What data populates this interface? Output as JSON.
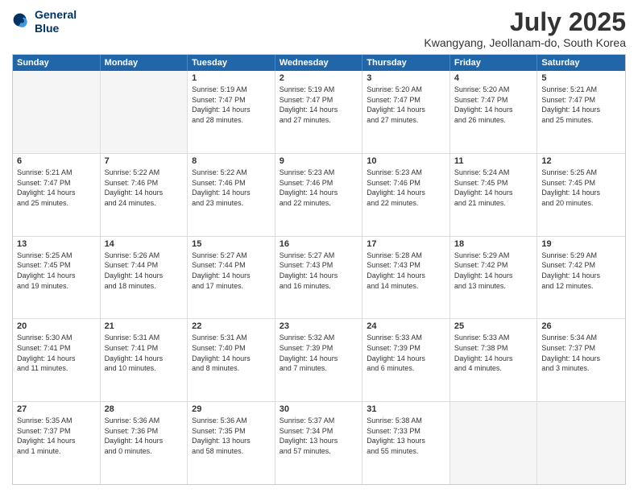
{
  "header": {
    "logo_line1": "General",
    "logo_line2": "Blue",
    "month": "July 2025",
    "location": "Kwangyang, Jeollanam-do, South Korea"
  },
  "weekdays": [
    "Sunday",
    "Monday",
    "Tuesday",
    "Wednesday",
    "Thursday",
    "Friday",
    "Saturday"
  ],
  "rows": [
    [
      {
        "day": "",
        "empty": true
      },
      {
        "day": "",
        "empty": true
      },
      {
        "day": "1",
        "lines": [
          "Sunrise: 5:19 AM",
          "Sunset: 7:47 PM",
          "Daylight: 14 hours",
          "and 28 minutes."
        ]
      },
      {
        "day": "2",
        "lines": [
          "Sunrise: 5:19 AM",
          "Sunset: 7:47 PM",
          "Daylight: 14 hours",
          "and 27 minutes."
        ]
      },
      {
        "day": "3",
        "lines": [
          "Sunrise: 5:20 AM",
          "Sunset: 7:47 PM",
          "Daylight: 14 hours",
          "and 27 minutes."
        ]
      },
      {
        "day": "4",
        "lines": [
          "Sunrise: 5:20 AM",
          "Sunset: 7:47 PM",
          "Daylight: 14 hours",
          "and 26 minutes."
        ]
      },
      {
        "day": "5",
        "lines": [
          "Sunrise: 5:21 AM",
          "Sunset: 7:47 PM",
          "Daylight: 14 hours",
          "and 25 minutes."
        ]
      }
    ],
    [
      {
        "day": "6",
        "lines": [
          "Sunrise: 5:21 AM",
          "Sunset: 7:47 PM",
          "Daylight: 14 hours",
          "and 25 minutes."
        ]
      },
      {
        "day": "7",
        "lines": [
          "Sunrise: 5:22 AM",
          "Sunset: 7:46 PM",
          "Daylight: 14 hours",
          "and 24 minutes."
        ]
      },
      {
        "day": "8",
        "lines": [
          "Sunrise: 5:22 AM",
          "Sunset: 7:46 PM",
          "Daylight: 14 hours",
          "and 23 minutes."
        ]
      },
      {
        "day": "9",
        "lines": [
          "Sunrise: 5:23 AM",
          "Sunset: 7:46 PM",
          "Daylight: 14 hours",
          "and 22 minutes."
        ]
      },
      {
        "day": "10",
        "lines": [
          "Sunrise: 5:23 AM",
          "Sunset: 7:46 PM",
          "Daylight: 14 hours",
          "and 22 minutes."
        ]
      },
      {
        "day": "11",
        "lines": [
          "Sunrise: 5:24 AM",
          "Sunset: 7:45 PM",
          "Daylight: 14 hours",
          "and 21 minutes."
        ]
      },
      {
        "day": "12",
        "lines": [
          "Sunrise: 5:25 AM",
          "Sunset: 7:45 PM",
          "Daylight: 14 hours",
          "and 20 minutes."
        ]
      }
    ],
    [
      {
        "day": "13",
        "lines": [
          "Sunrise: 5:25 AM",
          "Sunset: 7:45 PM",
          "Daylight: 14 hours",
          "and 19 minutes."
        ]
      },
      {
        "day": "14",
        "lines": [
          "Sunrise: 5:26 AM",
          "Sunset: 7:44 PM",
          "Daylight: 14 hours",
          "and 18 minutes."
        ]
      },
      {
        "day": "15",
        "lines": [
          "Sunrise: 5:27 AM",
          "Sunset: 7:44 PM",
          "Daylight: 14 hours",
          "and 17 minutes."
        ]
      },
      {
        "day": "16",
        "lines": [
          "Sunrise: 5:27 AM",
          "Sunset: 7:43 PM",
          "Daylight: 14 hours",
          "and 16 minutes."
        ]
      },
      {
        "day": "17",
        "lines": [
          "Sunrise: 5:28 AM",
          "Sunset: 7:43 PM",
          "Daylight: 14 hours",
          "and 14 minutes."
        ]
      },
      {
        "day": "18",
        "lines": [
          "Sunrise: 5:29 AM",
          "Sunset: 7:42 PM",
          "Daylight: 14 hours",
          "and 13 minutes."
        ]
      },
      {
        "day": "19",
        "lines": [
          "Sunrise: 5:29 AM",
          "Sunset: 7:42 PM",
          "Daylight: 14 hours",
          "and 12 minutes."
        ]
      }
    ],
    [
      {
        "day": "20",
        "lines": [
          "Sunrise: 5:30 AM",
          "Sunset: 7:41 PM",
          "Daylight: 14 hours",
          "and 11 minutes."
        ]
      },
      {
        "day": "21",
        "lines": [
          "Sunrise: 5:31 AM",
          "Sunset: 7:41 PM",
          "Daylight: 14 hours",
          "and 10 minutes."
        ]
      },
      {
        "day": "22",
        "lines": [
          "Sunrise: 5:31 AM",
          "Sunset: 7:40 PM",
          "Daylight: 14 hours",
          "and 8 minutes."
        ]
      },
      {
        "day": "23",
        "lines": [
          "Sunrise: 5:32 AM",
          "Sunset: 7:39 PM",
          "Daylight: 14 hours",
          "and 7 minutes."
        ]
      },
      {
        "day": "24",
        "lines": [
          "Sunrise: 5:33 AM",
          "Sunset: 7:39 PM",
          "Daylight: 14 hours",
          "and 6 minutes."
        ]
      },
      {
        "day": "25",
        "lines": [
          "Sunrise: 5:33 AM",
          "Sunset: 7:38 PM",
          "Daylight: 14 hours",
          "and 4 minutes."
        ]
      },
      {
        "day": "26",
        "lines": [
          "Sunrise: 5:34 AM",
          "Sunset: 7:37 PM",
          "Daylight: 14 hours",
          "and 3 minutes."
        ]
      }
    ],
    [
      {
        "day": "27",
        "lines": [
          "Sunrise: 5:35 AM",
          "Sunset: 7:37 PM",
          "Daylight: 14 hours",
          "and 1 minute."
        ]
      },
      {
        "day": "28",
        "lines": [
          "Sunrise: 5:36 AM",
          "Sunset: 7:36 PM",
          "Daylight: 14 hours",
          "and 0 minutes."
        ]
      },
      {
        "day": "29",
        "lines": [
          "Sunrise: 5:36 AM",
          "Sunset: 7:35 PM",
          "Daylight: 13 hours",
          "and 58 minutes."
        ]
      },
      {
        "day": "30",
        "lines": [
          "Sunrise: 5:37 AM",
          "Sunset: 7:34 PM",
          "Daylight: 13 hours",
          "and 57 minutes."
        ]
      },
      {
        "day": "31",
        "lines": [
          "Sunrise: 5:38 AM",
          "Sunset: 7:33 PM",
          "Daylight: 13 hours",
          "and 55 minutes."
        ]
      },
      {
        "day": "",
        "empty": true
      },
      {
        "day": "",
        "empty": true
      }
    ]
  ]
}
